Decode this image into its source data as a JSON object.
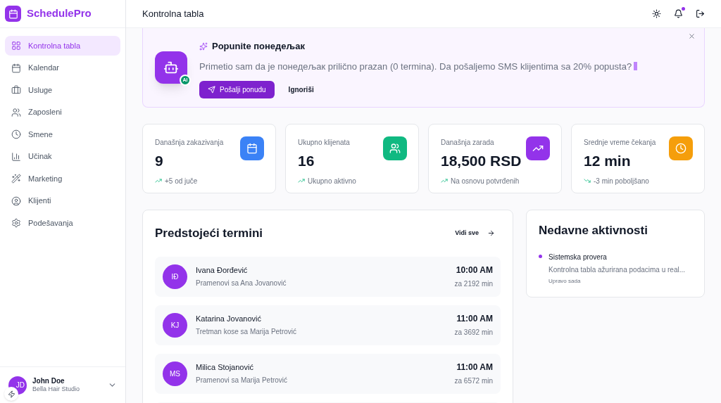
{
  "brand": "SchedulePro",
  "sidebar": {
    "items": [
      {
        "label": "Kontrolna tabla",
        "selected": true
      },
      {
        "label": "Kalendar",
        "selected": false
      },
      {
        "label": "Usluge",
        "selected": false
      },
      {
        "label": "Zaposleni",
        "selected": false
      },
      {
        "label": "Smene",
        "selected": false
      },
      {
        "label": "Učinak",
        "selected": false
      },
      {
        "label": "Marketing",
        "selected": false
      },
      {
        "label": "Klijenti",
        "selected": false
      },
      {
        "label": "Podešavanja",
        "selected": false
      }
    ],
    "user": {
      "initials": "JD",
      "name": "John Doe",
      "studio": "Bella Hair Studio"
    }
  },
  "header": {
    "title": "Kontrolna tabla",
    "notification_dot": true
  },
  "banner": {
    "title": "Popunite понедељак",
    "badge": "AI",
    "message": "Primetio sam da je понедељак prilično prazan (0 termina). Da pošaljemo SMS klijentima sa 20% popusta?",
    "primary": "Pošalji ponudu",
    "secondary": "Ignoriši"
  },
  "stats": [
    {
      "label": "Današnja zakazivanja",
      "value": "9",
      "note": "+5 od juče",
      "rising": true,
      "color": "#3b82f6"
    },
    {
      "label": "Ukupno klijenata",
      "value": "16",
      "note": "Ukupno aktivno",
      "rising": true,
      "color": "#10b981"
    },
    {
      "label": "Današnja zarada",
      "value": "18,500 RSD",
      "note": "Na osnovu potvrđenih",
      "rising": true,
      "color": "#9333ea"
    },
    {
      "label": "Srednje vreme čekanja",
      "value": "12 min",
      "note": "-3 min poboljšano",
      "rising": false,
      "color": "#f59e0b"
    }
  ],
  "appointments": {
    "title": "Predstojeći termini",
    "link": "Vidi sve",
    "items": [
      {
        "initials": "IĐ",
        "name": "Ivana Đorđević",
        "service": "Pramenovi sa Ana Jovanović",
        "time": "10:00 AM",
        "eta": "za 2192 min"
      },
      {
        "initials": "KJ",
        "name": "Katarina Jovanović",
        "service": "Tretman kose sa Marija Petrović",
        "time": "11:00 AM",
        "eta": "za 3692 min"
      },
      {
        "initials": "MS",
        "name": "Milica Stojanović",
        "service": "Pramenovi sa Marija Petrović",
        "time": "11:00 AM",
        "eta": "za 6572 min"
      }
    ]
  },
  "activity": {
    "title": "Nedavne aktivnosti",
    "items": [
      {
        "title": "Sistemska provera",
        "text": "Kontrolna tabla ažurirana podacima u real...",
        "time": "Upravo sada"
      }
    ]
  }
}
